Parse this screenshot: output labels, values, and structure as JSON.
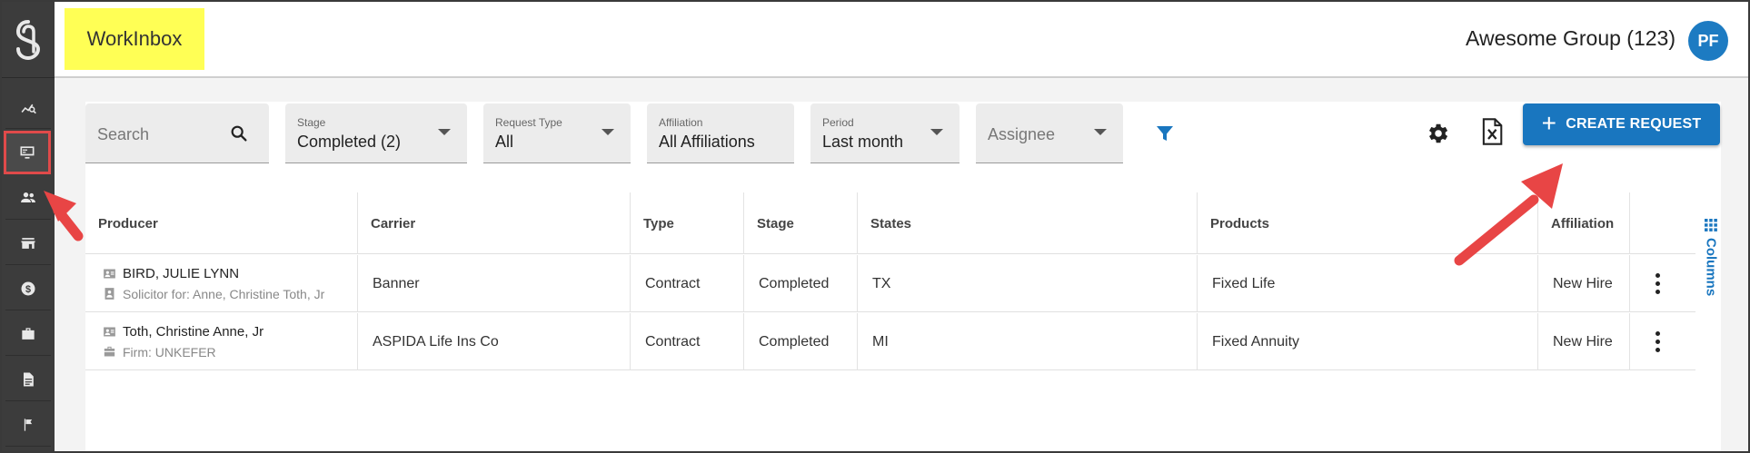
{
  "header": {
    "title": "WorkInbox",
    "group_name": "Awesome Group (123)",
    "avatar_initials": "PF"
  },
  "sidebar": {
    "items": [
      {
        "icon": "analytics-icon"
      },
      {
        "icon": "monitor-icon",
        "active": true
      },
      {
        "icon": "people-icon"
      },
      {
        "icon": "store-icon"
      },
      {
        "icon": "dollar-icon"
      },
      {
        "icon": "briefcase-icon"
      },
      {
        "icon": "document-icon"
      },
      {
        "icon": "flag-icon"
      }
    ]
  },
  "filters": {
    "search_placeholder": "Search",
    "stage": {
      "label": "Stage",
      "value": "Completed (2)"
    },
    "request_type": {
      "label": "Request Type",
      "value": "All"
    },
    "affiliation": {
      "label": "Affiliation",
      "value": "All Affiliations"
    },
    "period": {
      "label": "Period",
      "value": "Last month"
    },
    "assignee_placeholder": "Assignee"
  },
  "toolbar": {
    "create_label": "CREATE REQUEST",
    "create_plus": "+"
  },
  "table": {
    "headers": [
      "Producer",
      "Carrier",
      "Type",
      "Stage",
      "States",
      "Products",
      "Affiliation"
    ],
    "rows": [
      {
        "producer": "BIRD, JULIE LYNN",
        "producer_sub": "Solicitor for: Anne, Christine Toth, Jr",
        "carrier": "Banner",
        "type": "Contract",
        "stage": "Completed",
        "states": "TX",
        "products": "Fixed Life",
        "affiliation": "New Hire"
      },
      {
        "producer": "Toth, Christine Anne, Jr",
        "producer_sub": "Firm: UNKEFER",
        "carrier": "ASPIDA Life Ins Co",
        "type": "Contract",
        "stage": "Completed",
        "states": "MI",
        "products": "Fixed Annuity",
        "affiliation": "New Hire"
      }
    ],
    "columns_tab_label": "Columns"
  },
  "colors": {
    "accent": "#1976bf",
    "highlight": "#ffff55",
    "annotation": "#e84545",
    "sidebar": "#3c3c3c"
  }
}
